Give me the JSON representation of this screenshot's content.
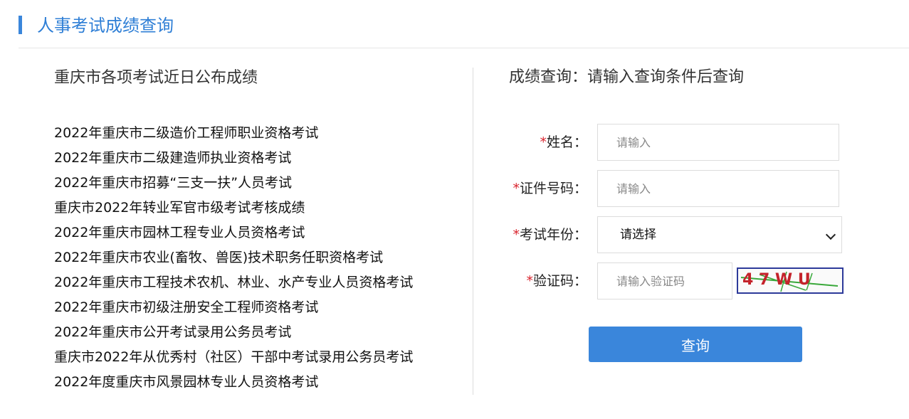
{
  "header": {
    "title": "人事考试成绩查询"
  },
  "left": {
    "title": "重庆市各项考试近日公布成绩",
    "exams": [
      "2022年重庆市二级造价工程师职业资格考试",
      "2022年重庆市二级建造师执业资格考试",
      "2022年重庆市招募“三支一扶”人员考试",
      "重庆市2022年转业军官市级考试考核成绩",
      "2022年重庆市园林工程专业人员资格考试",
      "2022年重庆市农业(畜牧、兽医)技术职务任职资格考试",
      "2022年重庆市工程技术农机、林业、水产专业人员资格考试",
      "2022年重庆市初级注册安全工程师资格考试",
      "2022年重庆市公开考试录用公务员考试",
      "重庆市2022年从优秀村（社区）干部中考试录用公务员考试",
      "2022年度重庆市风景园林专业人员资格考试"
    ]
  },
  "right": {
    "title": "成绩查询：请输入查询条件后查询",
    "required_mark": "*",
    "name": {
      "label": "姓名：",
      "placeholder": "请输入"
    },
    "id_number": {
      "label": "证件号码：",
      "placeholder": "请输入"
    },
    "year": {
      "label": "考试年份：",
      "selected": "请选择"
    },
    "captcha": {
      "label": "验证码：",
      "placeholder": "请输入验证码",
      "code": "4 7 W U"
    },
    "submit_label": "查询"
  },
  "colors": {
    "accent": "#3a86db",
    "required": "#d9232d"
  }
}
